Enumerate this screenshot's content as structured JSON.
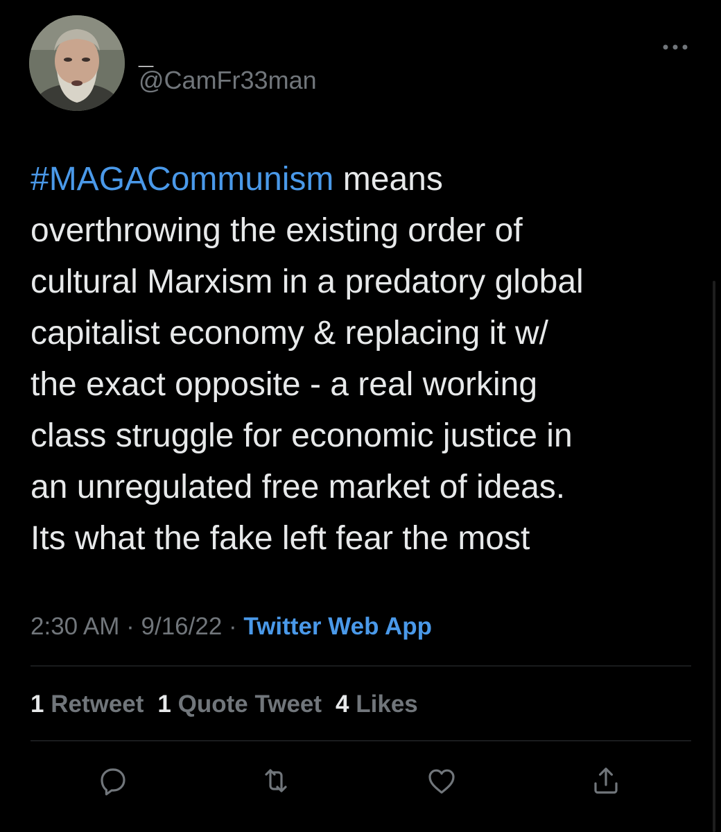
{
  "author": {
    "display_name": "_",
    "handle": "@CamFr33man"
  },
  "tweet": {
    "hashtag": "#MAGACommunism",
    "body": " means\noverthrowing the existing order of\ncultural Marxism in a predatory global\ncapitalist economy & replacing it w/\nthe exact opposite - a real working\nclass struggle for economic justice in\nan unregulated free market of ideas.\nIts what the fake left fear the most"
  },
  "meta": {
    "time": "2:30 AM",
    "separator": " · ",
    "date": "9/16/22",
    "source": "Twitter Web App"
  },
  "stats": [
    {
      "count": "1",
      "label": "Retweet"
    },
    {
      "count": "1",
      "label": "Quote Tweet"
    },
    {
      "count": "4",
      "label": "Likes"
    }
  ],
  "icons": {
    "more": "more-horizontal-icon",
    "reply": "reply-icon",
    "retweet": "retweet-icon",
    "like": "heart-icon",
    "share": "share-icon"
  },
  "colors": {
    "background": "#000000",
    "text": "#e7e9ea",
    "muted": "#71767b",
    "accent": "#4a99e9",
    "divider": "#2f3336"
  }
}
